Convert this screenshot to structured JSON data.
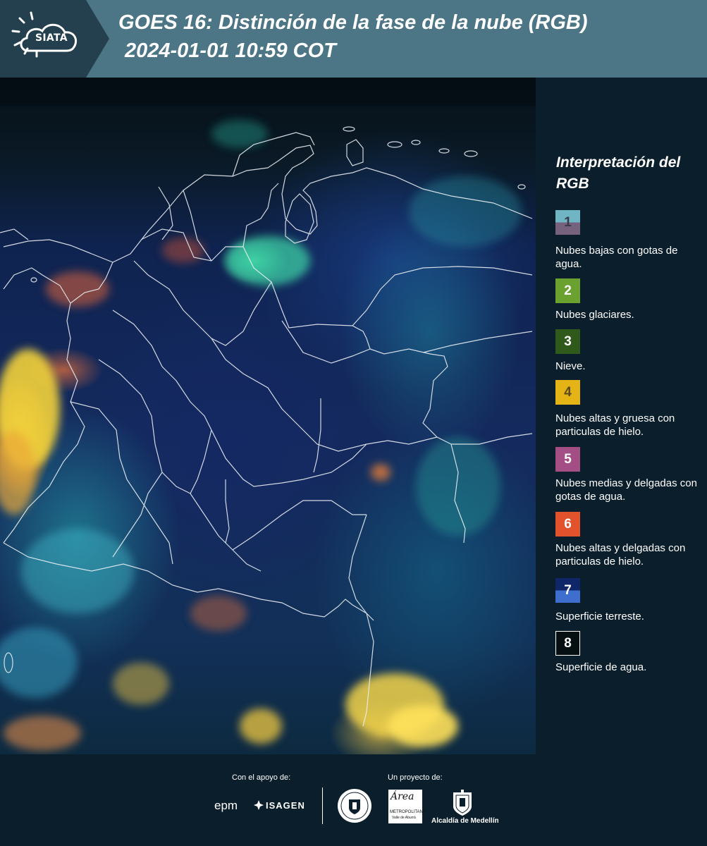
{
  "header": {
    "brand": "SIATA",
    "title_line1": "GOES 16: Distinción de la fase de la nube (RGB)",
    "title_line2": "2024-01-01 10:59 COT",
    "background_color": "#4c7585"
  },
  "map": {
    "icon": "satellite-rgb-cloud-phase-image",
    "overlay": "colombia-department-boundaries"
  },
  "legend": {
    "title": "Interpretación del RGB",
    "items": [
      {
        "number": "1",
        "label": "Nubes bajas con gotas de agua.",
        "color_top": "#6fb5c3",
        "color_bottom": "#76627c"
      },
      {
        "number": "2",
        "label": "Nubes glaciares.",
        "color": "#6aa12f"
      },
      {
        "number": "3",
        "label": "Nieve.",
        "color": "#2f5a1b"
      },
      {
        "number": "4",
        "label": "Nubes altas y gruesa con particulas de hielo.",
        "color": "#e4b315"
      },
      {
        "number": "5",
        "label": "Nubes medias y delgadas con gotas de agua.",
        "color": "#a34f85"
      },
      {
        "number": "6",
        "label": "Nubes altas y delgadas con particulas de hielo.",
        "color": "#e2522c"
      },
      {
        "number": "7",
        "label": "Superficie terreste.",
        "color_top": "#0f2669",
        "color_bottom": "#3f6fce"
      },
      {
        "number": "8",
        "label": "Superficie de agua.",
        "color": "#061012"
      }
    ]
  },
  "footer": {
    "support_label": "Con el apoyo de:",
    "project_label": "Un proyecto de:",
    "sponsors": [
      "epm",
      "ISAGEN"
    ],
    "area_logo": {
      "name": "Área",
      "line1": "METROPOLITANA",
      "line2": "Valle de Aburrá"
    },
    "alcaldia": "Alcaldía de Medellín"
  }
}
